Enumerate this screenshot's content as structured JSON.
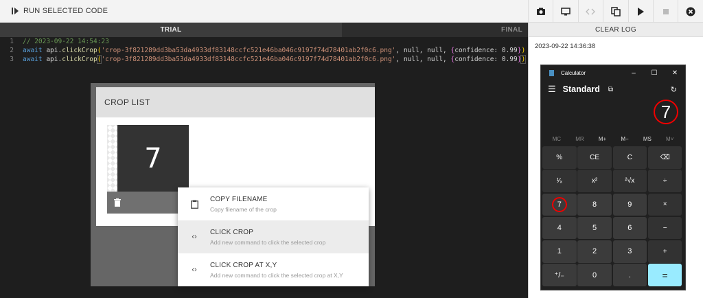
{
  "toolbar": {
    "run_label": "RUN SELECTED CODE"
  },
  "tools": [
    "camera-icon",
    "monitor-icon",
    "code-icon",
    "copy-icon",
    "play-icon",
    "stop-icon",
    "close-icon"
  ],
  "tabs": {
    "trial": "TRIAL",
    "final": "FINAL"
  },
  "editor": {
    "lines": [
      {
        "n": "1",
        "comment": "// 2023-09-22 14:54:23"
      },
      {
        "n": "2",
        "kw": "await",
        "obj": " api.",
        "fn": "clickCrop",
        "open": "(",
        "str": "'crop-3f821289dd3ba53da4933df83148ccfc521e46ba046c9197f74d78401ab2f0c6.png'",
        "rest": ", null, null, ",
        "brace_open": "{",
        "conf": "confidence: 0.99",
        "brace_close": "}",
        "close": ")"
      },
      {
        "n": "3",
        "kw": "await",
        "obj": " api.",
        "fn": "clickCrop",
        "open": "(",
        "str": "'crop-3f821289dd3ba53da4933df83148ccfc521e46ba046c9197f74d78401ab2f0c6.png'",
        "rest": ", null, null, ",
        "brace_open": "{",
        "conf": "confidence: 0.99",
        "brace_close": "}",
        "close": ")"
      }
    ]
  },
  "log": {
    "clear_label": "CLEAR LOG",
    "timestamp": "2023-09-22 14:36:38"
  },
  "calculator": {
    "title": "Calculator",
    "mode": "Standard",
    "display": "7",
    "memory": [
      "MC",
      "MR",
      "M+",
      "M−",
      "MS",
      "M˅"
    ],
    "keys": [
      "%",
      "CE",
      "C",
      "⌫",
      "¹⁄ₓ",
      "x²",
      "²√x",
      "÷",
      "7",
      "8",
      "9",
      "×",
      "4",
      "5",
      "6",
      "−",
      "1",
      "2",
      "3",
      "+",
      "⁺/₋",
      "0",
      ".",
      "="
    ]
  },
  "crop_list": {
    "title": "CROP LIST",
    "thumb_digit": "7",
    "menu": [
      {
        "title": "COPY FILENAME",
        "sub": "Copy filename of the crop"
      },
      {
        "title": "CLICK CROP",
        "sub": "Add new command to click the selected crop"
      },
      {
        "title": "CLICK CROP AT X,Y",
        "sub": "Add new command to click the selected crop at X,Y"
      }
    ]
  }
}
